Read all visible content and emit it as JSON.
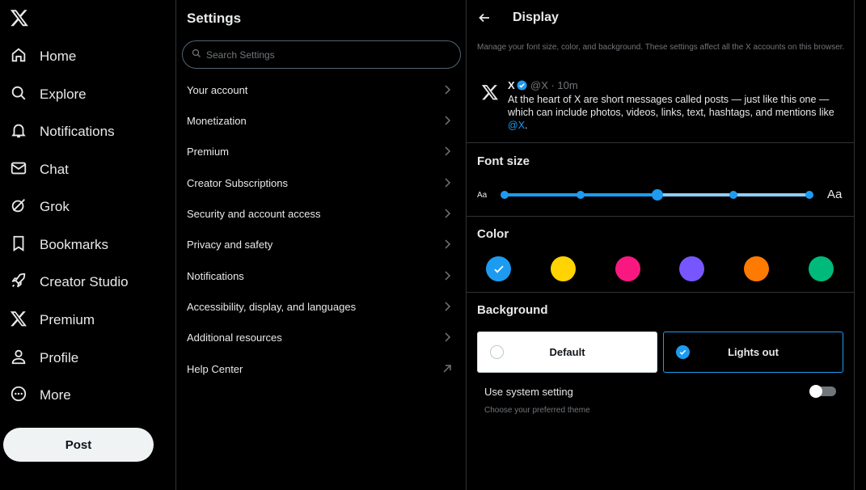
{
  "nav": {
    "items": [
      {
        "label": "Home",
        "icon": "home-icon"
      },
      {
        "label": "Explore",
        "icon": "search-icon"
      },
      {
        "label": "Notifications",
        "icon": "bell-icon"
      },
      {
        "label": "Chat",
        "icon": "mail-icon"
      },
      {
        "label": "Grok",
        "icon": "grok-icon"
      },
      {
        "label": "Bookmarks",
        "icon": "bookmark-icon"
      },
      {
        "label": "Creator Studio",
        "icon": "rocket-icon"
      },
      {
        "label": "Premium",
        "icon": "x-logo-icon"
      },
      {
        "label": "Profile",
        "icon": "person-icon"
      },
      {
        "label": "More",
        "icon": "more-circle-icon"
      }
    ],
    "post_label": "Post"
  },
  "settings": {
    "title": "Settings",
    "search_placeholder": "Search Settings",
    "items": [
      {
        "label": "Your account",
        "icon": "chevron-right-icon"
      },
      {
        "label": "Monetization",
        "icon": "chevron-right-icon"
      },
      {
        "label": "Premium",
        "icon": "chevron-right-icon"
      },
      {
        "label": "Creator Subscriptions",
        "icon": "chevron-right-icon"
      },
      {
        "label": "Security and account access",
        "icon": "chevron-right-icon"
      },
      {
        "label": "Privacy and safety",
        "icon": "chevron-right-icon"
      },
      {
        "label": "Notifications",
        "icon": "chevron-right-icon"
      },
      {
        "label": "Accessibility, display, and languages",
        "icon": "chevron-right-icon"
      },
      {
        "label": "Additional resources",
        "icon": "chevron-right-icon"
      },
      {
        "label": "Help Center",
        "icon": "external-link-icon"
      }
    ]
  },
  "display": {
    "title": "Display",
    "description": "Manage your font size, color, and background. These settings affect all the X accounts on this browser.",
    "sample_post": {
      "name": "X",
      "meta": "@X · 10m",
      "text": "At the heart of X are short messages called posts — just like this one — which can include photos, videos, links, text, hashtags, and mentions like ",
      "mention": "@X",
      "trailing": "."
    },
    "font_size": {
      "title": "Font size",
      "small_label": "Aa",
      "large_label": "Aa",
      "steps": 5,
      "selected_step": 3
    },
    "color": {
      "title": "Color",
      "options": [
        "#1d9bf0",
        "#ffd400",
        "#f91880",
        "#7856ff",
        "#ff7a00",
        "#00ba7c"
      ],
      "selected_index": 0
    },
    "background": {
      "title": "Background",
      "options": [
        {
          "label": "Default",
          "selected": false
        },
        {
          "label": "Lights out",
          "selected": true
        }
      ],
      "system_setting_label": "Use system setting",
      "system_setting_hint": "Choose your preferred theme",
      "system_setting_enabled": false
    }
  }
}
